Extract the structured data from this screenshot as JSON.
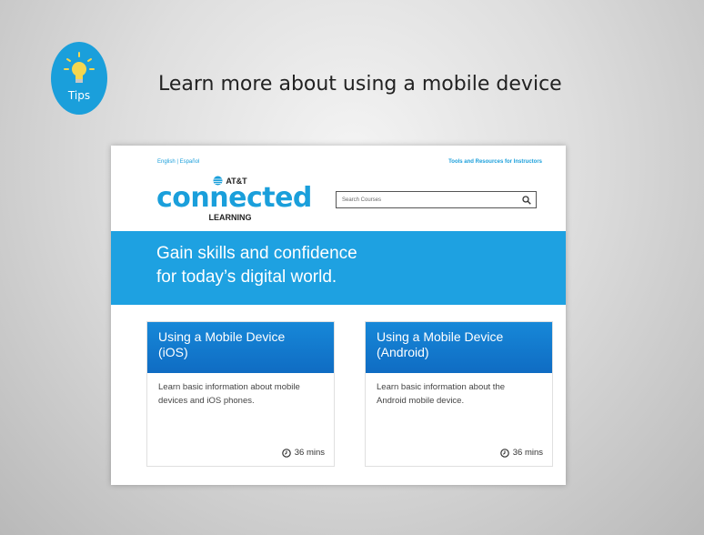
{
  "slide": {
    "tips_label": "Tips",
    "title": "Learn more about using a mobile device"
  },
  "site": {
    "lang_links": "English | Español",
    "instructor_link": "Tools and Resources for Instructors",
    "logo": {
      "brand": "AT&T",
      "name": "connected",
      "subname": "LEARNING"
    },
    "search": {
      "placeholder": "Search Courses"
    },
    "hero": {
      "line1": "Gain skills and confidence",
      "line2": "for today’s digital world."
    },
    "courses": [
      {
        "title_line1": "Using a Mobile Device",
        "title_line2": "(iOS)",
        "desc_line1": "Learn basic information about mobile",
        "desc_line2": "devices and iOS phones.",
        "duration": "36 mins"
      },
      {
        "title_line1": "Using a Mobile Device",
        "title_line2": "(Android)",
        "desc_line1": "Learn basic information about the",
        "desc_line2": "Android mobile device.",
        "duration": "36 mins"
      }
    ]
  },
  "colors": {
    "accent": "#1a9fdb",
    "hero_bg": "#1ea1e1",
    "card_header": "#1279cd"
  },
  "icons": {
    "tips": "lightbulb-icon",
    "search": "search-icon",
    "duration": "clock-icon",
    "brand": "att-globe-icon"
  }
}
